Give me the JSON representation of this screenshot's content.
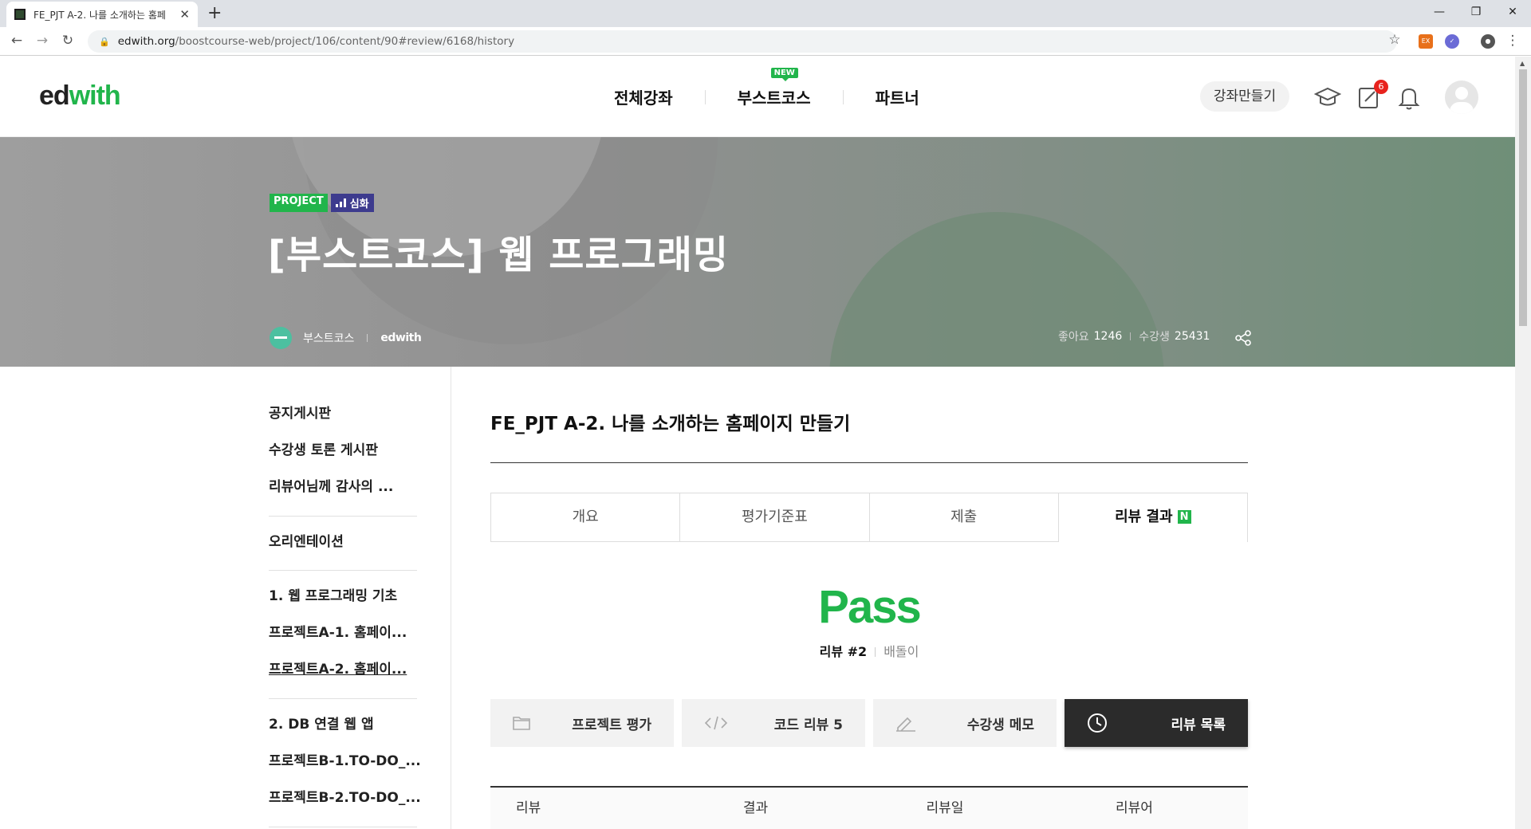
{
  "browser": {
    "tab_title": "FE_PJT A-2. 나를 소개하는 홈페",
    "url_host": "edwith.org",
    "url_path": "/boostcourse-web/project/106/content/90#review/6168/history"
  },
  "header": {
    "logo_ed": "ed",
    "logo_with": "with",
    "nav": [
      "전체강좌",
      "부스트코스",
      "파트너"
    ],
    "new_badge": "NEW",
    "make_course": "강좌만들기",
    "notification_count": "6"
  },
  "hero": {
    "badge_project": "PROJECT",
    "badge_level": "심화",
    "title": "[부스트코스] 웹 프로그래밍",
    "provider": "부스트코스",
    "provider2": "edwith",
    "likes_label": "좋아요",
    "likes": "1246",
    "students_label": "수강생",
    "students": "25431"
  },
  "sidebar": {
    "group1": [
      "공지게시판",
      "수강생 토론 게시판",
      "리뷰어님께 감사의 ..."
    ],
    "group2": [
      "오리엔테이션"
    ],
    "group3": [
      "1. 웹 프로그래밍 기초",
      "프로젝트A-1. 홈페이...",
      "프로젝트A-2. 홈페이..."
    ],
    "group4": [
      "2. DB 연결 웹 앱",
      "프로젝트B-1.TO-DO_...",
      "프로젝트B-2.TO-DO_..."
    ]
  },
  "main": {
    "title": "FE_PJT A-2. 나를 소개하는 홈페이지 만들기",
    "tabs": [
      "개요",
      "평가기준표",
      "제출",
      "리뷰 결과"
    ],
    "tab_new": "N",
    "result": "Pass",
    "review_label": "리뷰 #2",
    "reviewer": "배돌이",
    "actions": [
      "프로젝트 평가",
      "코드 리뷰 5",
      "수강생 메모",
      "리뷰 목록"
    ],
    "columns": [
      "리뷰",
      "결과",
      "리뷰일",
      "리뷰어"
    ]
  },
  "colors": {
    "accent": "#21b54b",
    "level_badge": "#3d3b8e",
    "dark_button": "#2b2b2b"
  }
}
